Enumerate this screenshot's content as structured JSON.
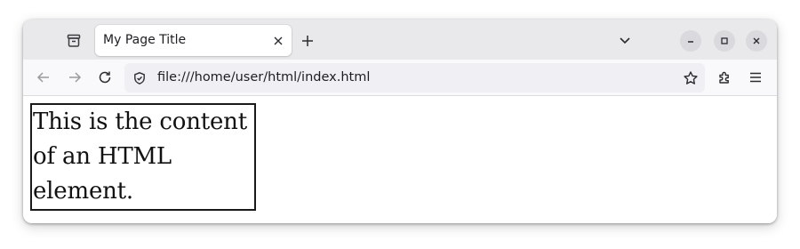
{
  "tab": {
    "title": "My Page Title",
    "close_icon": "close-icon"
  },
  "toolbar": {
    "new_tab_icon": "plus-icon",
    "tab_list_icon": "chevron-down-icon",
    "window_controls": [
      "minimize-icon",
      "maximize-icon",
      "close-icon"
    ]
  },
  "navigation": {
    "back_icon": "arrow-left-icon",
    "forward_icon": "arrow-right-icon",
    "reload_icon": "reload-icon",
    "site_info_icon": "shield-icon",
    "url": "file:///home/user/html/index.html",
    "bookmark_icon": "star-icon",
    "extensions_icon": "puzzle-icon",
    "menu_icon": "hamburger-menu-icon"
  },
  "page": {
    "element_text": "This is the content of an HTML element."
  },
  "colors": {
    "tabstrip_bg": "#e9e9ec",
    "navbar_bg": "#f9f9fb",
    "urlbar_bg": "#f0f0f4",
    "window_button_bg": "#dadade",
    "element_border": "#1a1a1a"
  }
}
